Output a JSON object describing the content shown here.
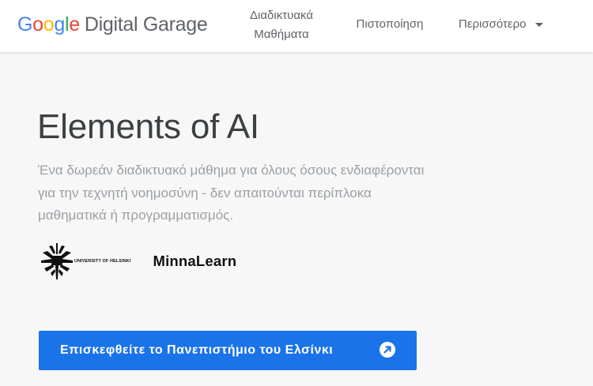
{
  "header": {
    "logo": {
      "google": "Google",
      "product": "Digital Garage"
    },
    "nav": {
      "courses_line1": "Διαδικτυακά",
      "courses_line2": "Μαθήματα",
      "certification": "Πιστοποίηση",
      "more": "Περισσότερο"
    }
  },
  "main": {
    "title": "Elements of AI",
    "subtitle": "Ένα δωρεάν διαδικτυακό μάθημα για όλους όσους ενδιαφέρονται για την τεχνητή νοημοσύνη - δεν απαιτούνται περίπλοκα μαθηματικά ή προγραμματισμός.",
    "partners": {
      "university": "UNIVERSITY OF HELSINKI",
      "minna": "MinnaLearn"
    },
    "cta": {
      "label": "Επισκεφθείτε το Πανεπιστήμιο του Ελσίνκι",
      "icon": "external-link-arrow-icon"
    }
  },
  "colors": {
    "accent": "#1a73e8",
    "google_blue": "#4285f4",
    "google_red": "#ea4335",
    "google_yellow": "#fbbc05",
    "google_green": "#34a853"
  }
}
